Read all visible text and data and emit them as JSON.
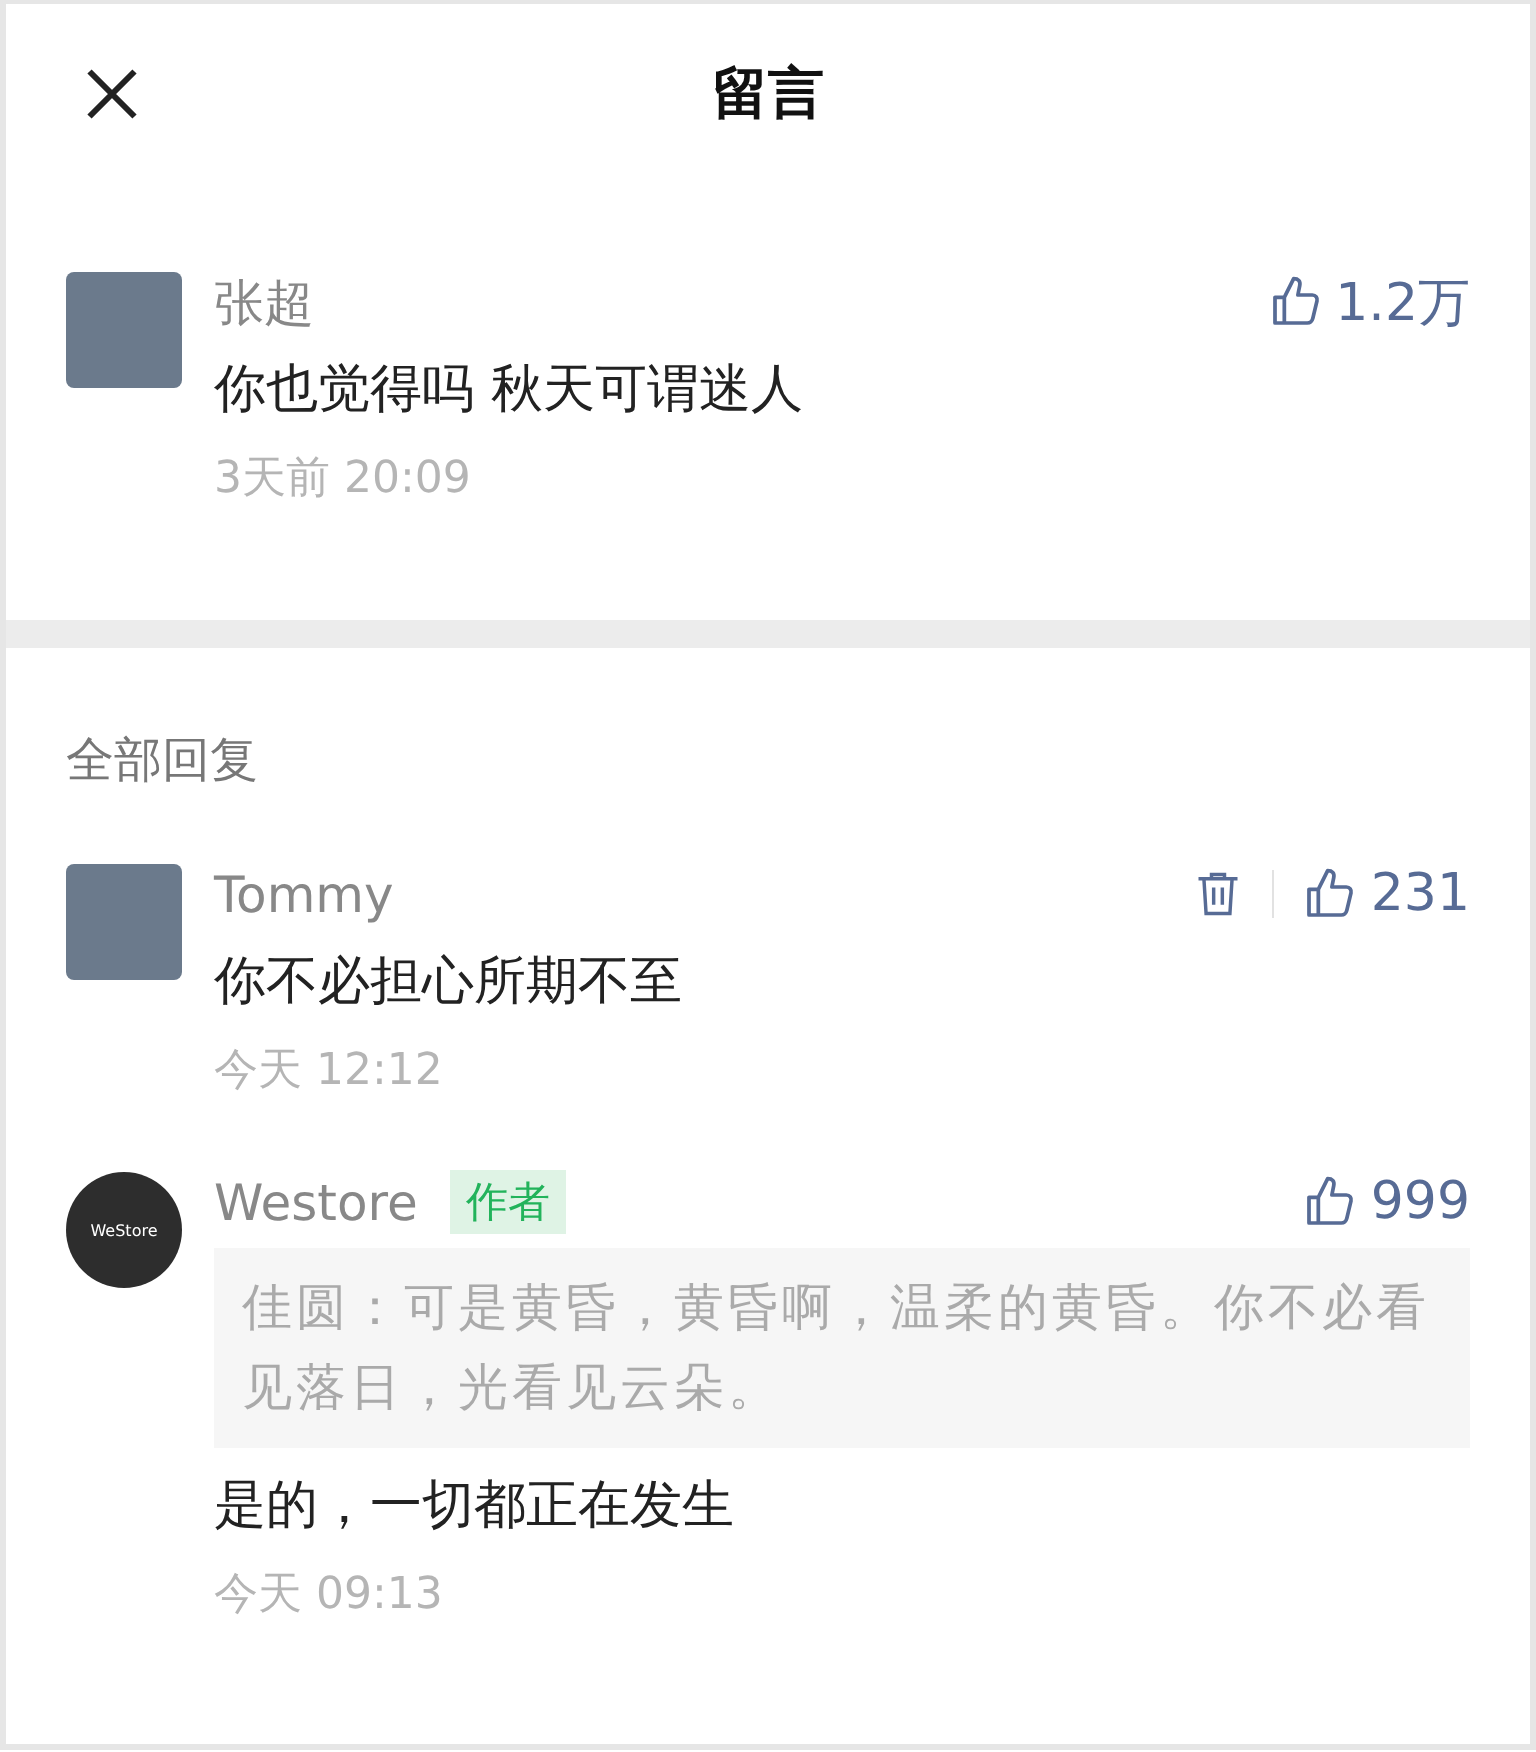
{
  "header": {
    "title": "留言"
  },
  "main_comment": {
    "avatar": {
      "kind": "photo"
    },
    "name": "张超",
    "likes": "1.2万",
    "content": "你也觉得吗 秋天可谓迷人",
    "time": "3天前 20:09",
    "deletable": false
  },
  "replies_heading": "全部回复",
  "replies": [
    {
      "avatar": {
        "kind": "photo"
      },
      "name": "Tommy",
      "likes": "231",
      "content": "你不必担心所期不至",
      "time": "今天 12:12",
      "deletable": true
    },
    {
      "avatar": {
        "kind": "logo",
        "text": "WeStore"
      },
      "name": "Westore",
      "badge": "作者",
      "likes": "999",
      "quote": "佳圆：可是黄昏，黄昏啊，温柔的黄昏。你不必看见落日，光看见云朵。",
      "content": "是的，一切都正在发生",
      "time": "今天 09:13",
      "deletable": false
    }
  ]
}
